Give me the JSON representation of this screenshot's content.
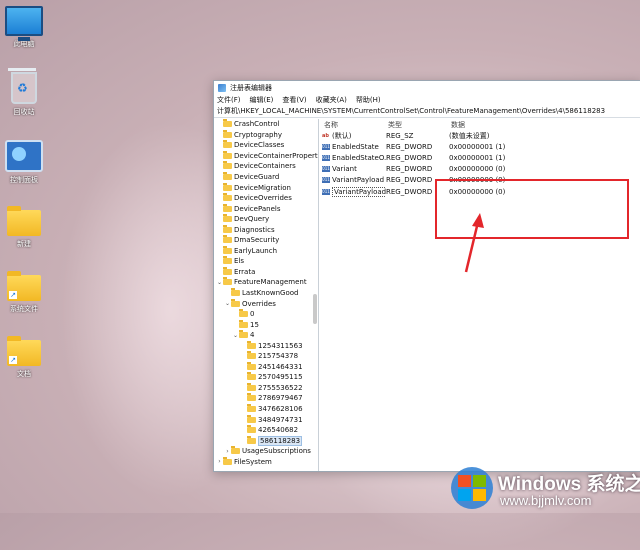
{
  "desktop": {
    "icons": [
      {
        "label": "此电脑",
        "icon": "monitor-icon"
      },
      {
        "label": "回收站",
        "icon": "recycle-bin-icon"
      },
      {
        "label": "控制面板",
        "icon": "control-panel-icon"
      },
      {
        "label": "新建",
        "icon": "folder-icon"
      },
      {
        "label": "系统文件",
        "icon": "folder-shortcut-icon"
      },
      {
        "label": "文档",
        "icon": "folder-shortcut-icon"
      }
    ]
  },
  "window": {
    "title": "注册表编辑器",
    "menu": [
      "文件(F)",
      "编辑(E)",
      "查看(V)",
      "收藏夹(A)",
      "帮助(H)"
    ],
    "address": "计算机\\HKEY_LOCAL_MACHINE\\SYSTEM\\CurrentControlSet\\Control\\FeatureManagement\\Overrides\\4\\586118283",
    "tree": [
      {
        "label": "CrashControl",
        "indent": 0,
        "toggle": ""
      },
      {
        "label": "Cryptography",
        "indent": 0,
        "toggle": ""
      },
      {
        "label": "DeviceClasses",
        "indent": 0,
        "toggle": ""
      },
      {
        "label": "DeviceContainerPropertyUpda",
        "indent": 0,
        "toggle": ""
      },
      {
        "label": "DeviceContainers",
        "indent": 0,
        "toggle": ""
      },
      {
        "label": "DeviceGuard",
        "indent": 0,
        "toggle": ""
      },
      {
        "label": "DeviceMigration",
        "indent": 0,
        "toggle": ""
      },
      {
        "label": "DeviceOverrides",
        "indent": 0,
        "toggle": ""
      },
      {
        "label": "DevicePanels",
        "indent": 0,
        "toggle": ""
      },
      {
        "label": "DevQuery",
        "indent": 0,
        "toggle": ""
      },
      {
        "label": "Diagnostics",
        "indent": 0,
        "toggle": ""
      },
      {
        "label": "DmaSecurity",
        "indent": 0,
        "toggle": ""
      },
      {
        "label": "EarlyLaunch",
        "indent": 0,
        "toggle": ""
      },
      {
        "label": "Els",
        "indent": 0,
        "toggle": ""
      },
      {
        "label": "Errata",
        "indent": 0,
        "toggle": ""
      },
      {
        "label": "FeatureManagement",
        "indent": 0,
        "toggle": "v"
      },
      {
        "label": "LastKnownGood",
        "indent": 1,
        "toggle": ""
      },
      {
        "label": "Overrides",
        "indent": 1,
        "toggle": "v"
      },
      {
        "label": "0",
        "indent": 2,
        "toggle": ""
      },
      {
        "label": "15",
        "indent": 2,
        "toggle": ""
      },
      {
        "label": "4",
        "indent": 2,
        "toggle": "v"
      },
      {
        "label": "1254311563",
        "indent": 3,
        "toggle": ""
      },
      {
        "label": "215754378",
        "indent": 3,
        "toggle": ""
      },
      {
        "label": "2451464331",
        "indent": 3,
        "toggle": ""
      },
      {
        "label": "2570495115",
        "indent": 3,
        "toggle": ""
      },
      {
        "label": "2755536522",
        "indent": 3,
        "toggle": ""
      },
      {
        "label": "2786979467",
        "indent": 3,
        "toggle": ""
      },
      {
        "label": "3476628106",
        "indent": 3,
        "toggle": ""
      },
      {
        "label": "3484974731",
        "indent": 3,
        "toggle": ""
      },
      {
        "label": "426540682",
        "indent": 3,
        "toggle": ""
      },
      {
        "label": "586118283",
        "indent": 3,
        "toggle": "",
        "selected": true
      },
      {
        "label": "UsageSubscriptions",
        "indent": 1,
        "toggle": ">"
      },
      {
        "label": "FileSystem",
        "indent": 0,
        "toggle": ">"
      }
    ],
    "columns": [
      "名称",
      "类型",
      "数据"
    ],
    "values": [
      {
        "name": "(默认)",
        "type": "REG_SZ",
        "data": "(数值未设置)",
        "icon": "string-value-icon"
      },
      {
        "name": "EnabledState",
        "type": "REG_DWORD",
        "data": "0x00000001 (1)",
        "icon": "binary-value-icon"
      },
      {
        "name": "EnabledStateO...",
        "type": "REG_DWORD",
        "data": "0x00000001 (1)",
        "icon": "binary-value-icon"
      },
      {
        "name": "Variant",
        "type": "REG_DWORD",
        "data": "0x00000000 (0)",
        "icon": "binary-value-icon"
      },
      {
        "name": "VariantPayload",
        "type": "REG_DWORD",
        "data": "0x00000000 (0)",
        "icon": "binary-value-icon"
      },
      {
        "name": "VariantPayload...",
        "type": "REG_DWORD",
        "data": "0x00000000 (0)",
        "icon": "binary-value-icon"
      }
    ]
  },
  "annotation": {
    "box_color": "#e3262b",
    "arrow_color": "#e3262b"
  },
  "watermark": {
    "title": "Windows 系统之家",
    "url": "www.bjjmlv.com"
  }
}
